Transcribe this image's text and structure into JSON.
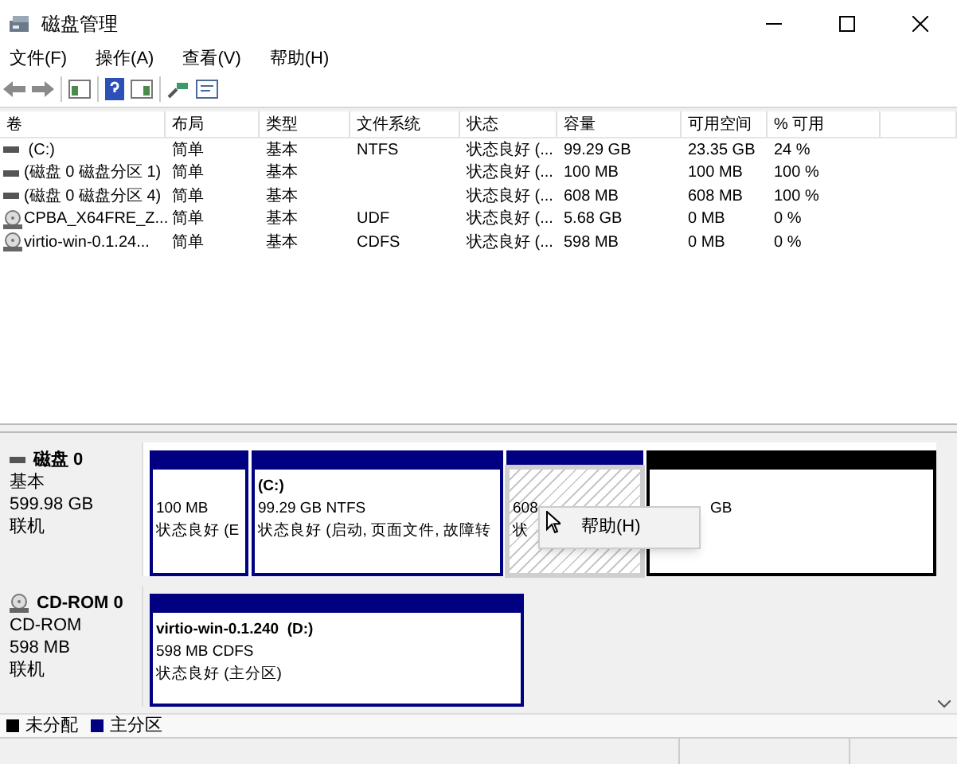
{
  "window": {
    "title": "磁盘管理"
  },
  "menu": [
    "文件(F)",
    "操作(A)",
    "查看(V)",
    "帮助(H)"
  ],
  "table": {
    "columns": [
      "卷",
      "布局",
      "类型",
      "文件系统",
      "状态",
      "容量",
      "可用空间",
      "% 可用"
    ],
    "rows": [
      {
        "kind": "disk",
        "cells": [
          " (C:)",
          "简单",
          "基本",
          "NTFS",
          "状态良好 (...",
          "99.29 GB",
          "23.35 GB",
          "24 %"
        ]
      },
      {
        "kind": "disk",
        "cells": [
          "(磁盘 0 磁盘分区 1)",
          "简单",
          "基本",
          "",
          "状态良好 (...",
          "100 MB",
          "100 MB",
          "100 %"
        ]
      },
      {
        "kind": "disk",
        "cells": [
          "(磁盘 0 磁盘分区 4)",
          "简单",
          "基本",
          "",
          "状态良好 (...",
          "608 MB",
          "608 MB",
          "100 %"
        ]
      },
      {
        "kind": "cdrom",
        "cells": [
          "CPBA_X64FRE_Z...",
          "简单",
          "基本",
          "UDF",
          "状态良好 (...",
          "5.68 GB",
          "0 MB",
          "0 %"
        ]
      },
      {
        "kind": "cdrom",
        "cells": [
          "virtio-win-0.1.24...",
          "简单",
          "基本",
          "CDFS",
          "状态良好 (...",
          "598 MB",
          "0 MB",
          "0 %"
        ]
      }
    ]
  },
  "disks": [
    {
      "kind": "disk",
      "name": "磁盘 0",
      "lines": [
        "基本",
        "599.98 GB",
        "联机"
      ],
      "partitions": [
        {
          "color": "#000080",
          "selected": false,
          "lines": [
            "100 MB",
            "状态良好 (E"
          ]
        },
        {
          "color": "#000080",
          "selected": false,
          "title": "(C:)",
          "lines": [
            "99.29 GB NTFS",
            "状态良好 (启动, 页面文件, 故障转"
          ]
        },
        {
          "color": "#000080",
          "selected": true,
          "lines": [
            "608",
            "状"
          ]
        },
        {
          "color": "#000000",
          "selected": false,
          "lines": [
            "GB"
          ],
          "offset": true
        }
      ]
    },
    {
      "kind": "cdrom",
      "name": "CD-ROM 0",
      "lines": [
        "CD-ROM",
        "598 MB",
        "联机"
      ],
      "partitions": [
        {
          "color": "#000080",
          "selected": false,
          "title": "virtio-win-0.1.240  (D:)",
          "lines": [
            "598 MB CDFS",
            "状态良好 (主分区)"
          ]
        }
      ]
    }
  ],
  "context_menu": [
    "帮助(H)"
  ],
  "legend": [
    {
      "label": "未分配",
      "color": "#000000"
    },
    {
      "label": "主分区",
      "color": "#000080"
    }
  ]
}
